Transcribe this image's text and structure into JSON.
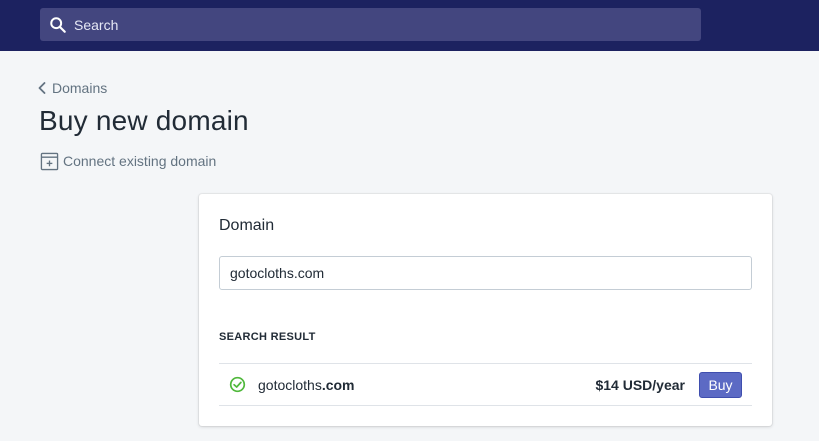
{
  "search": {
    "placeholder": "Search",
    "value": "",
    "icon": "search-icon"
  },
  "breadcrumb": {
    "label": "Domains",
    "icon": "chevron-left-icon"
  },
  "page": {
    "title": "Buy new domain"
  },
  "actions": {
    "connect_label": "Connect existing domain",
    "connect_icon": "add-window-icon"
  },
  "card": {
    "title": "Domain",
    "input_value": "gotocloths.com",
    "section_label": "SEARCH RESULT",
    "result": {
      "name": "gotocloths",
      "tld": ".com",
      "price": "$14 USD/year",
      "buy_label": "Buy",
      "status_icon": "check-circle-icon"
    }
  },
  "colors": {
    "topbar": "#1c2260",
    "search_bg": "#43467f",
    "accent": "#5c6ac4",
    "success": "#50b83c"
  }
}
